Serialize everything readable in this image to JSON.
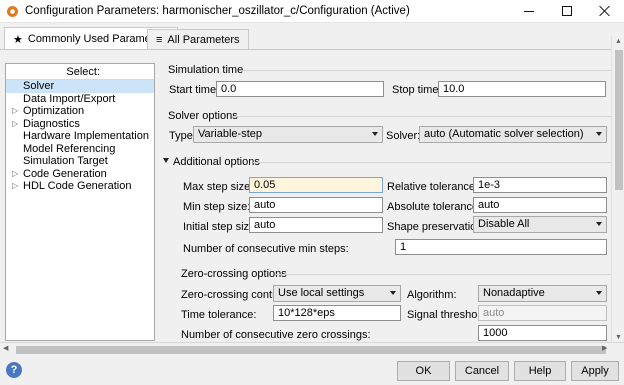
{
  "window": {
    "title": "Configuration Parameters: harmonischer_oszillator_c/Configuration (Active)"
  },
  "tabs": [
    {
      "label": "Commonly Used Parameters",
      "icon": "star-icon"
    },
    {
      "label": "All Parameters",
      "icon": "list-icon"
    }
  ],
  "select_panel": {
    "heading": "Select:",
    "items": [
      {
        "label": "Solver",
        "expandable": false,
        "selected": true
      },
      {
        "label": "Data Import/Export",
        "expandable": false
      },
      {
        "label": "Optimization",
        "expandable": true
      },
      {
        "label": "Diagnostics",
        "expandable": true
      },
      {
        "label": "Hardware Implementation",
        "expandable": false
      },
      {
        "label": "Model Referencing",
        "expandable": false
      },
      {
        "label": "Simulation Target",
        "expandable": false
      },
      {
        "label": "Code Generation",
        "expandable": true
      },
      {
        "label": "HDL Code Generation",
        "expandable": true
      }
    ]
  },
  "simulation_time": {
    "title": "Simulation time",
    "start_label": "Start time:",
    "start_value": "0.0",
    "stop_label": "Stop time:",
    "stop_value": "10.0"
  },
  "solver_options": {
    "title": "Solver options",
    "type_label": "Type:",
    "type_value": "Variable-step",
    "solver_label": "Solver:",
    "solver_value": "auto (Automatic solver selection)"
  },
  "additional_options": {
    "title": "Additional options",
    "max_step_label": "Max step size:",
    "max_step_value": "0.05",
    "rel_tol_label": "Relative tolerance:",
    "rel_tol_value": "1e-3",
    "min_step_label": "Min step size:",
    "min_step_value": "auto",
    "abs_tol_label": "Absolute tolerance:",
    "abs_tol_value": "auto",
    "init_step_label": "Initial step size:",
    "init_step_value": "auto",
    "shape_label": "Shape preservation:",
    "shape_value": "Disable All",
    "consec_min_label": "Number of consecutive min steps:",
    "consec_min_value": "1"
  },
  "zero_crossing": {
    "title": "Zero-crossing options",
    "control_label": "Zero-crossing control:",
    "control_value": "Use local settings",
    "algorithm_label": "Algorithm:",
    "algorithm_value": "Nonadaptive",
    "time_tol_label": "Time tolerance:",
    "time_tol_value": "10*128*eps",
    "signal_thr_label": "Signal threshold:",
    "signal_thr_value": "auto",
    "consec_zc_label": "Number of consecutive zero crossings:",
    "consec_zc_value": "1000"
  },
  "buttons": {
    "ok": "OK",
    "cancel": "Cancel",
    "help": "Help",
    "apply": "Apply"
  },
  "help_icon_glyph": "?"
}
